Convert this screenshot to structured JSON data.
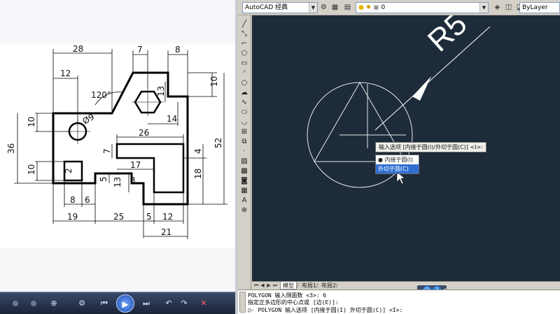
{
  "reference_drawing": {
    "dimensions": {
      "d28": "28",
      "d7_top": "7",
      "d8_top": "8",
      "d12_left": "12",
      "d10_right": "10",
      "d120": "120°",
      "d13_hex": "13",
      "d9_hole": "Ø9",
      "d10_left": "10",
      "d14": "14",
      "d26": "26",
      "d36": "36",
      "d52": "52",
      "d7_mid": "7",
      "d4": "4",
      "d17": "17",
      "d10_bottom": "10",
      "d2": "2",
      "d5_mid": "5",
      "d13_lower": "13",
      "d3": "3",
      "d18": "18",
      "d8_bottom": "8",
      "d6": "6",
      "d19": "19",
      "d25": "25",
      "d5_bottom": "5",
      "d12_bottom": "12",
      "d21": "21"
    }
  },
  "media_player": {
    "buttons": [
      "zoom",
      "settings",
      "rewind",
      "play",
      "forward",
      "undo",
      "redo",
      "close"
    ]
  },
  "autocad": {
    "toolbar": {
      "workspace_combo": "AutoCAD 经典",
      "layer_combo": "0",
      "linetype_combo": "ByLayer"
    },
    "canvas": {
      "dimension_label": "R5",
      "prompt": "输入选项 [内接于圆(I)/外切于圆(C)] <I>:",
      "menu_items": [
        {
          "label": "内接于圆(I)",
          "selected": false
        },
        {
          "label": "外切于圆(C)",
          "selected": true
        }
      ]
    },
    "layout_tabs": [
      "模型",
      "布局1",
      "布局2"
    ],
    "command_lines": [
      "POLYGON 输入侧面数 <3>: 6",
      "指定正多边形的中心点或 [边(E)]:",
      "◯- POLYGON 输入选项 [内接于圆(I) 外切于圆(C)] <I>:"
    ]
  }
}
